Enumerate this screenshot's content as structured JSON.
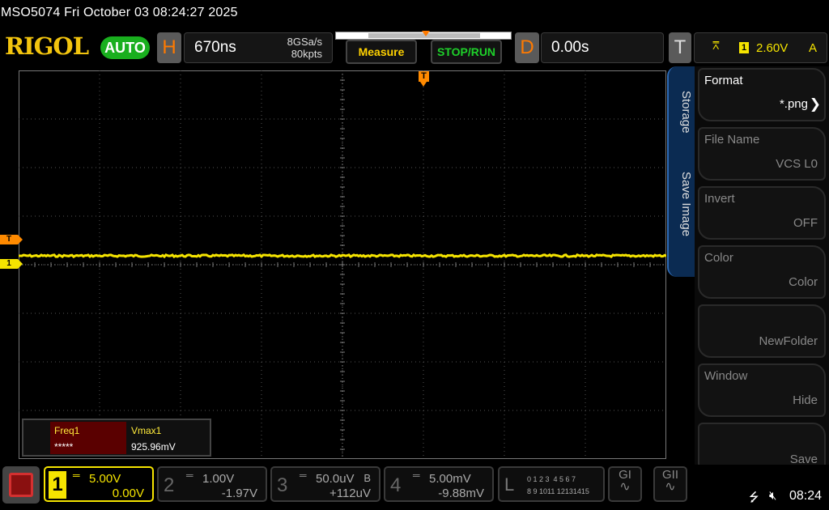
{
  "title": "MSO5074  Fri October 03 08:24:27 2025",
  "logo": "RIGOL",
  "mode": "AUTO",
  "horizontal": {
    "key": "H",
    "timebase": "670ns",
    "sample_rate": "8GSa/s",
    "mem_depth": "80kpts"
  },
  "buttons": {
    "measure": "Measure",
    "run": "STOP/RUN"
  },
  "delay": {
    "key": "D",
    "value": "0.00s"
  },
  "trigger": {
    "key": "T",
    "source": "1",
    "level": "2.60V",
    "mode": "A",
    "marker": "T"
  },
  "markers": {
    "trigger_level": "T",
    "channel1": "1"
  },
  "measurements": [
    {
      "label": "Freq1",
      "value": "*****"
    },
    {
      "label": "Vmax1",
      "value": "925.96mV"
    }
  ],
  "side_tabs": [
    "Storage",
    "Save Image"
  ],
  "menu": [
    {
      "title": "Format",
      "value": "*.png"
    },
    {
      "title": "File Name",
      "value": "VCS L0"
    },
    {
      "title": "Invert",
      "value": "OFF"
    },
    {
      "title": "Color",
      "value": "Color"
    },
    {
      "title": "",
      "value": "NewFolder"
    },
    {
      "title": "Window",
      "value": "Hide"
    },
    {
      "title": "",
      "value": "Save"
    }
  ],
  "channels": [
    {
      "num": "1",
      "coupling": "DC",
      "scale": "5.00V",
      "offset": "0.00V",
      "bw": ""
    },
    {
      "num": "2",
      "coupling": "DC",
      "scale": "1.00V",
      "offset": "-1.97V",
      "bw": ""
    },
    {
      "num": "3",
      "coupling": "DC",
      "scale": "50.0uV",
      "offset": "+112uV",
      "bw": "B"
    },
    {
      "num": "4",
      "coupling": "DC",
      "scale": "5.00mV",
      "offset": "-9.88mV",
      "bw": ""
    }
  ],
  "logic": {
    "key": "L",
    "row1": "0 1 2 3  4 5 6 7",
    "row2": "8 9 1011 12131415"
  },
  "generators": [
    {
      "label": "GI"
    },
    {
      "label": "GII"
    }
  ],
  "status": {
    "time": "08:24"
  },
  "colors": {
    "ch1": "#f5e400",
    "accent_orange": "#ff8a00",
    "menu_blue": "#2e6bb5"
  }
}
